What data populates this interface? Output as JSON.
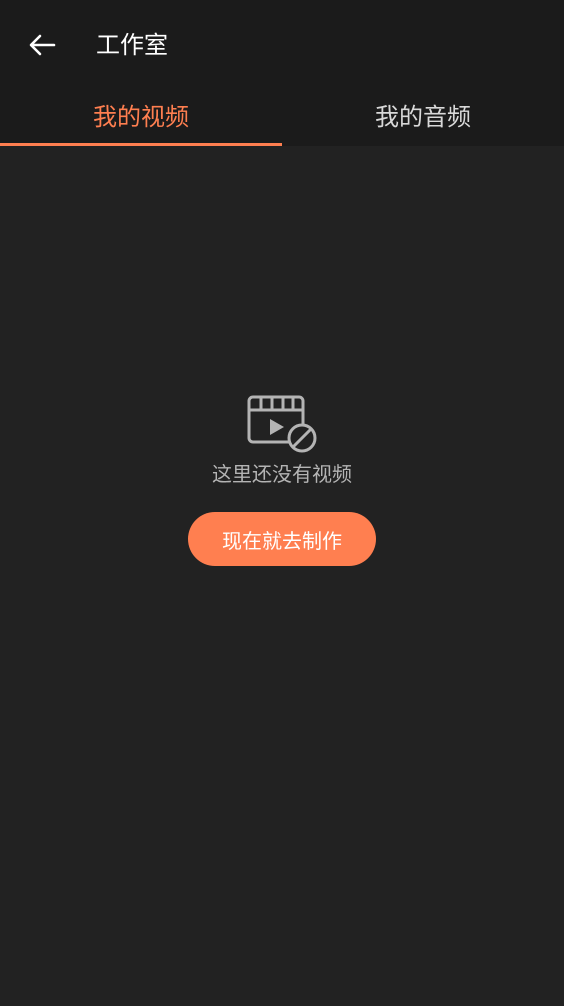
{
  "header": {
    "title": "工作室",
    "back_icon": "arrow-left-icon"
  },
  "tabs": [
    {
      "label": "我的视频",
      "selected": true
    },
    {
      "label": "我的音频",
      "selected": false
    }
  ],
  "empty_state": {
    "icon": "video-unavailable-icon",
    "message": "这里还没有视频",
    "action_label": "现在就去制作"
  },
  "colors": {
    "accent": "#ff7f50",
    "inactive_tab": "#d9d9d9",
    "background": "#222222",
    "header_background": "#1b1b1b",
    "muted_text": "#b4b4b4"
  }
}
